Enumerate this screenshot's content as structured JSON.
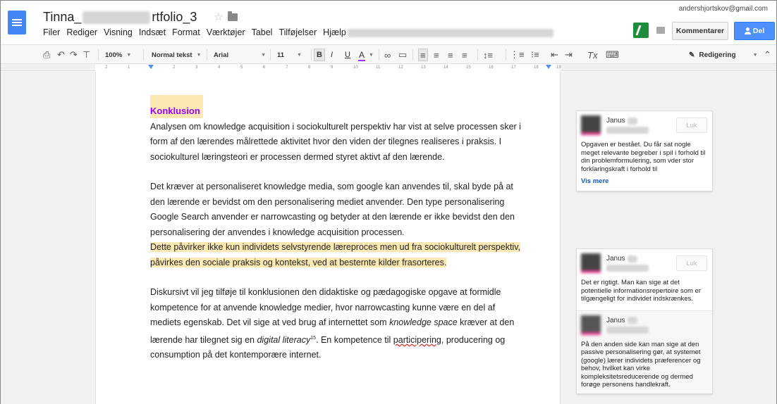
{
  "header": {
    "title_start": "Tinna_",
    "title_end": "rtfolio_3",
    "account": "andershjortskov@gmail.com",
    "comments_button": "Kommentarer",
    "share_button": "Del"
  },
  "menu": [
    "Filer",
    "Rediger",
    "Visning",
    "Indsæt",
    "Format",
    "Værktøjer",
    "Tabel",
    "Tilføjelser",
    "Hjælp"
  ],
  "toolbar": {
    "zoom": "100%",
    "style": "Normal tekst",
    "font": "Arial",
    "size": "11",
    "bold": "B",
    "italic": "I",
    "underline": "U",
    "text_color": "A",
    "mode": "Redigering"
  },
  "ruler": {
    "ticks": [
      "2",
      "1",
      "1",
      "2",
      "3",
      "4",
      "5",
      "6",
      "7",
      "8",
      "9",
      "10",
      "11",
      "12",
      "13",
      "14",
      "15",
      "16",
      "17",
      "18",
      "19"
    ]
  },
  "document": {
    "heading": "Konklusion",
    "p1": "Analysen om knowledge acquisition i sociokulturelt perspektiv har vist at selve processen sker i form af den lærendes målrettede aktivitet hvor den viden der tilegnes realiseres i praksis. I sociokulturel læringsteori er processen dermed styret aktivt af den lærende.",
    "p2": "Det kræver at personaliseret knowledge media, som google kan anvendes til, skal byde på at den lærende er bevidst om den personalisering mediet anvender. Den type personalisering Google Search anvender er narrowcasting og betyder at den lærende er ikke bevidst den den personalisering der anvendes i knowledge acquisition processen.",
    "p2_highlight": "Dette påvirker ikke kun individets selvstyrende læreproces men ud fra sociokulturelt perspektiv, påvirkes den sociale praksis og kontekst, ved at besternte kilder frasorteres.",
    "p3_a": "Diskursivt vil jeg tilføje til konklusionen den didaktiske og pædagogiske opgave at formidle kompetence for at anvende knowledge medier, hvor narrowcasting kunne være en del af mediets egenskab. Det vil sige at ved brug af internettet som ",
    "p3_italic1": "knowledge space",
    "p3_b": " kræver at den lærende har tilegnet sig en ",
    "p3_italic2": "digital literacy",
    "p3_sup": "15",
    "p3_c": ". En kompetence til ",
    "p3_underline": "participering",
    "p3_d": ", producering og consumption på det kontemporære internet."
  },
  "comments": [
    {
      "name": "Janus",
      "close": "Luk",
      "text": "Opgaven er bestået. Du får sat nogle meget relevante begreber i spil i forhold til din problemformulering, som vder stor forklaringskraft i forhold til",
      "more": "Vis mere"
    },
    {
      "name": "Janus",
      "close": "Luk",
      "text": "Det er rigtigt. Man kan sige at det potentielle informationsrepertoire som er tilgængeligt for individet indskrænkes."
    },
    {
      "name": "Janus",
      "text": "På den anden side kan man sige at den passive personalisering gør, at systemet (google) lærer individets præferencer og behov, hvilket kan virke kompleksitetsreducerende og dermed forøge personens handlekraft."
    }
  ],
  "colors": {
    "accent": "#4285f4",
    "highlight": "#fce8b2",
    "heading": "#9900ff",
    "comment_avatar_bar": "#e33b8c"
  }
}
